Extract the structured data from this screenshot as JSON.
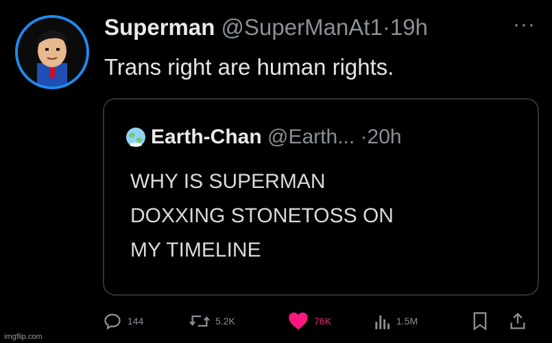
{
  "tweet": {
    "author_name": "Superman",
    "author_handle": "@SuperManAt1",
    "separator": "·",
    "time": "19h",
    "more_label": "···",
    "text": "Trans right are human rights."
  },
  "quote": {
    "author_name": "Earth-Chan",
    "author_handle": "@Earth...",
    "separator": "·",
    "time": "20h",
    "lines": [
      "WHY IS SUPERMAN",
      "DOXXING STONETOSS ON",
      "MY TIMELINE"
    ]
  },
  "actions": {
    "reply_count": "144",
    "retweet_count": "5.2K",
    "like_count": "76K",
    "views_count": "1.5M"
  },
  "watermark": "imgflip.com",
  "colors": {
    "background": "#000000",
    "like": "#f91880",
    "avatar_ring": "#1d8cf0",
    "muted": "#8b9096"
  },
  "icons": [
    "reply-icon",
    "retweet-icon",
    "heart-icon",
    "views-icon",
    "bookmark-icon",
    "share-icon",
    "globe-icon"
  ]
}
